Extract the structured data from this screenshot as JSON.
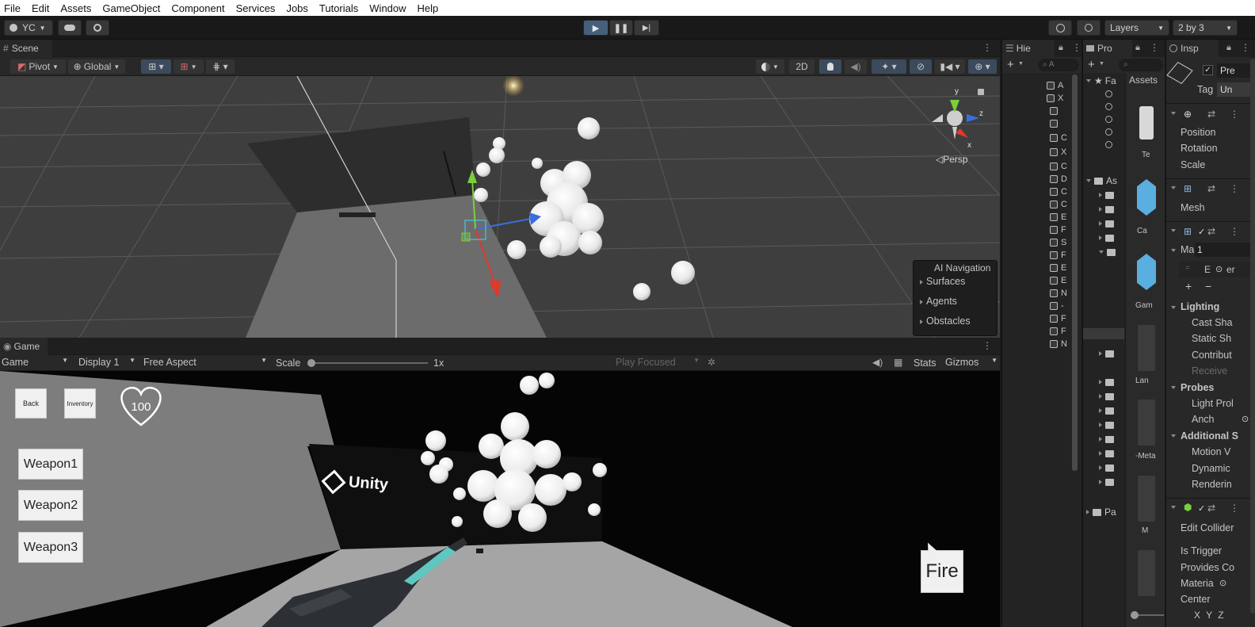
{
  "menu": [
    "File",
    "Edit",
    "Assets",
    "GameObject",
    "Component",
    "Services",
    "Jobs",
    "Tutorials",
    "Window",
    "Help"
  ],
  "toolbar": {
    "account": "YC",
    "layers": "Layers",
    "layout": "2 by 3"
  },
  "scene": {
    "tab": "Scene",
    "pivot": "Pivot",
    "global": "Global",
    "mode2d": "2D",
    "persp": "Persp",
    "gizmo_axes": {
      "y": "y",
      "z": "z",
      "x": "x"
    },
    "ai_navigation": {
      "title": "AI Navigation",
      "items": [
        "Surfaces",
        "Agents",
        "Obstacles"
      ]
    }
  },
  "game": {
    "tab": "Game",
    "view_select": "Game",
    "display": "Display 1",
    "aspect": "Free Aspect",
    "scale_label": "Scale",
    "scale_value": "1x",
    "play_focused": "Play Focused",
    "stats": "Stats",
    "gizmos": "Gizmos",
    "ui": {
      "back": "Back",
      "inventory": "Inventory",
      "health": "100",
      "weapons": [
        "Weapon1",
        "Weapon2",
        "Weapon3"
      ],
      "fire": "Fire",
      "logo": "Unity"
    }
  },
  "hierarchy": {
    "tab": "Hie",
    "search_placeholder": "A",
    "rows": [
      "A",
      "X",
      "",
      "",
      "C",
      "X",
      "C",
      "D",
      "C",
      "C",
      "E",
      "F",
      "S",
      "F",
      "E",
      "E",
      "N",
      "-",
      "F",
      "F",
      "N"
    ]
  },
  "project": {
    "tab": "Pro",
    "favorites": "Fa",
    "assets_root": "As",
    "packages": "Pa",
    "assets_header": "Assets",
    "thumbs": [
      "Te",
      "Ca",
      "Gam",
      "Lan",
      "-Meta",
      "M"
    ]
  },
  "inspector": {
    "tab": "Insp",
    "object_name": "Pre",
    "tag_label": "Tag",
    "tag_value": "Un",
    "transform": [
      "Position",
      "Rotation",
      "Scale"
    ],
    "mesh": "Mesh",
    "materials": "Ma",
    "materials_count": "1",
    "element": "E",
    "element_value": "er",
    "lighting": {
      "title": "Lighting",
      "items": [
        "Cast Sha",
        "Static Sh",
        "Contribut",
        "Receive"
      ]
    },
    "probes": {
      "title": "Probes",
      "items": [
        "Light Prol",
        "Anch"
      ]
    },
    "additional": {
      "title": "Additional S",
      "items": [
        "Motion V",
        "Dynamic",
        "Renderin"
      ]
    },
    "collider": [
      "Edit Collider",
      "Is Trigger",
      "Provides Co",
      "Materia",
      "Center"
    ],
    "center_axes": "X Y Z"
  }
}
